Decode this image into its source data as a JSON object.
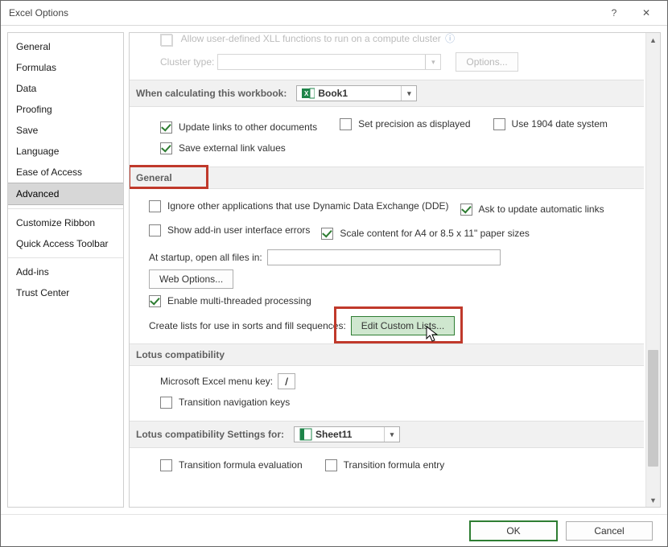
{
  "window": {
    "title": "Excel Options"
  },
  "sidebar": {
    "items": [
      {
        "label": "General"
      },
      {
        "label": "Formulas"
      },
      {
        "label": "Data"
      },
      {
        "label": "Proofing"
      },
      {
        "label": "Save"
      },
      {
        "label": "Language"
      },
      {
        "label": "Ease of Access"
      },
      {
        "label": "Advanced",
        "selected": true
      },
      {
        "label": "Customize Ribbon"
      },
      {
        "label": "Quick Access Toolbar"
      },
      {
        "label": "Add-ins"
      },
      {
        "label": "Trust Center"
      }
    ]
  },
  "truncated_top": {
    "line": "Allow user-defined XLL functions to run on a compute cluster",
    "cluster_label": "Cluster type:",
    "options_btn": "Options..."
  },
  "calc_section": {
    "heading": "When calculating this workbook:",
    "workbook": "Book1",
    "items": [
      {
        "label": "Update links to other documents",
        "checked": true
      },
      {
        "label": "Set precision as displayed",
        "checked": false
      },
      {
        "label": "Use 1904 date system",
        "checked": false
      },
      {
        "label": "Save external link values",
        "checked": true
      }
    ]
  },
  "general_section": {
    "heading": "General",
    "items": [
      {
        "label": "Ignore other applications that use Dynamic Data Exchange (DDE)",
        "checked": false
      },
      {
        "label": "Ask to update automatic links",
        "checked": true
      },
      {
        "label": "Show add-in user interface errors",
        "checked": false
      },
      {
        "label": "Scale content for A4 or 8.5 x 11\" paper sizes",
        "checked": true
      }
    ],
    "startup_label": "At startup, open all files in:",
    "startup_value": "",
    "web_options_btn": "Web Options...",
    "multithread": {
      "label": "Enable multi-threaded processing",
      "checked": true
    },
    "custom_lists_label": "Create lists for use in sorts and fill sequences:",
    "custom_lists_btn": "Edit Custom Lists..."
  },
  "lotus_section": {
    "heading": "Lotus compatibility",
    "menu_key_label": "Microsoft Excel menu key:",
    "menu_key_value": "/",
    "nav_keys": {
      "label": "Transition navigation keys",
      "checked": false
    }
  },
  "lotus_settings_section": {
    "heading": "Lotus compatibility Settings for:",
    "sheet": "Sheet11",
    "items": [
      {
        "label": "Transition formula evaluation",
        "checked": false
      },
      {
        "label": "Transition formula entry",
        "checked": false
      }
    ]
  },
  "footer": {
    "ok": "OK",
    "cancel": "Cancel"
  },
  "scrollbar": {
    "thumb_top_pct": 68,
    "thumb_height_pct": 26
  }
}
